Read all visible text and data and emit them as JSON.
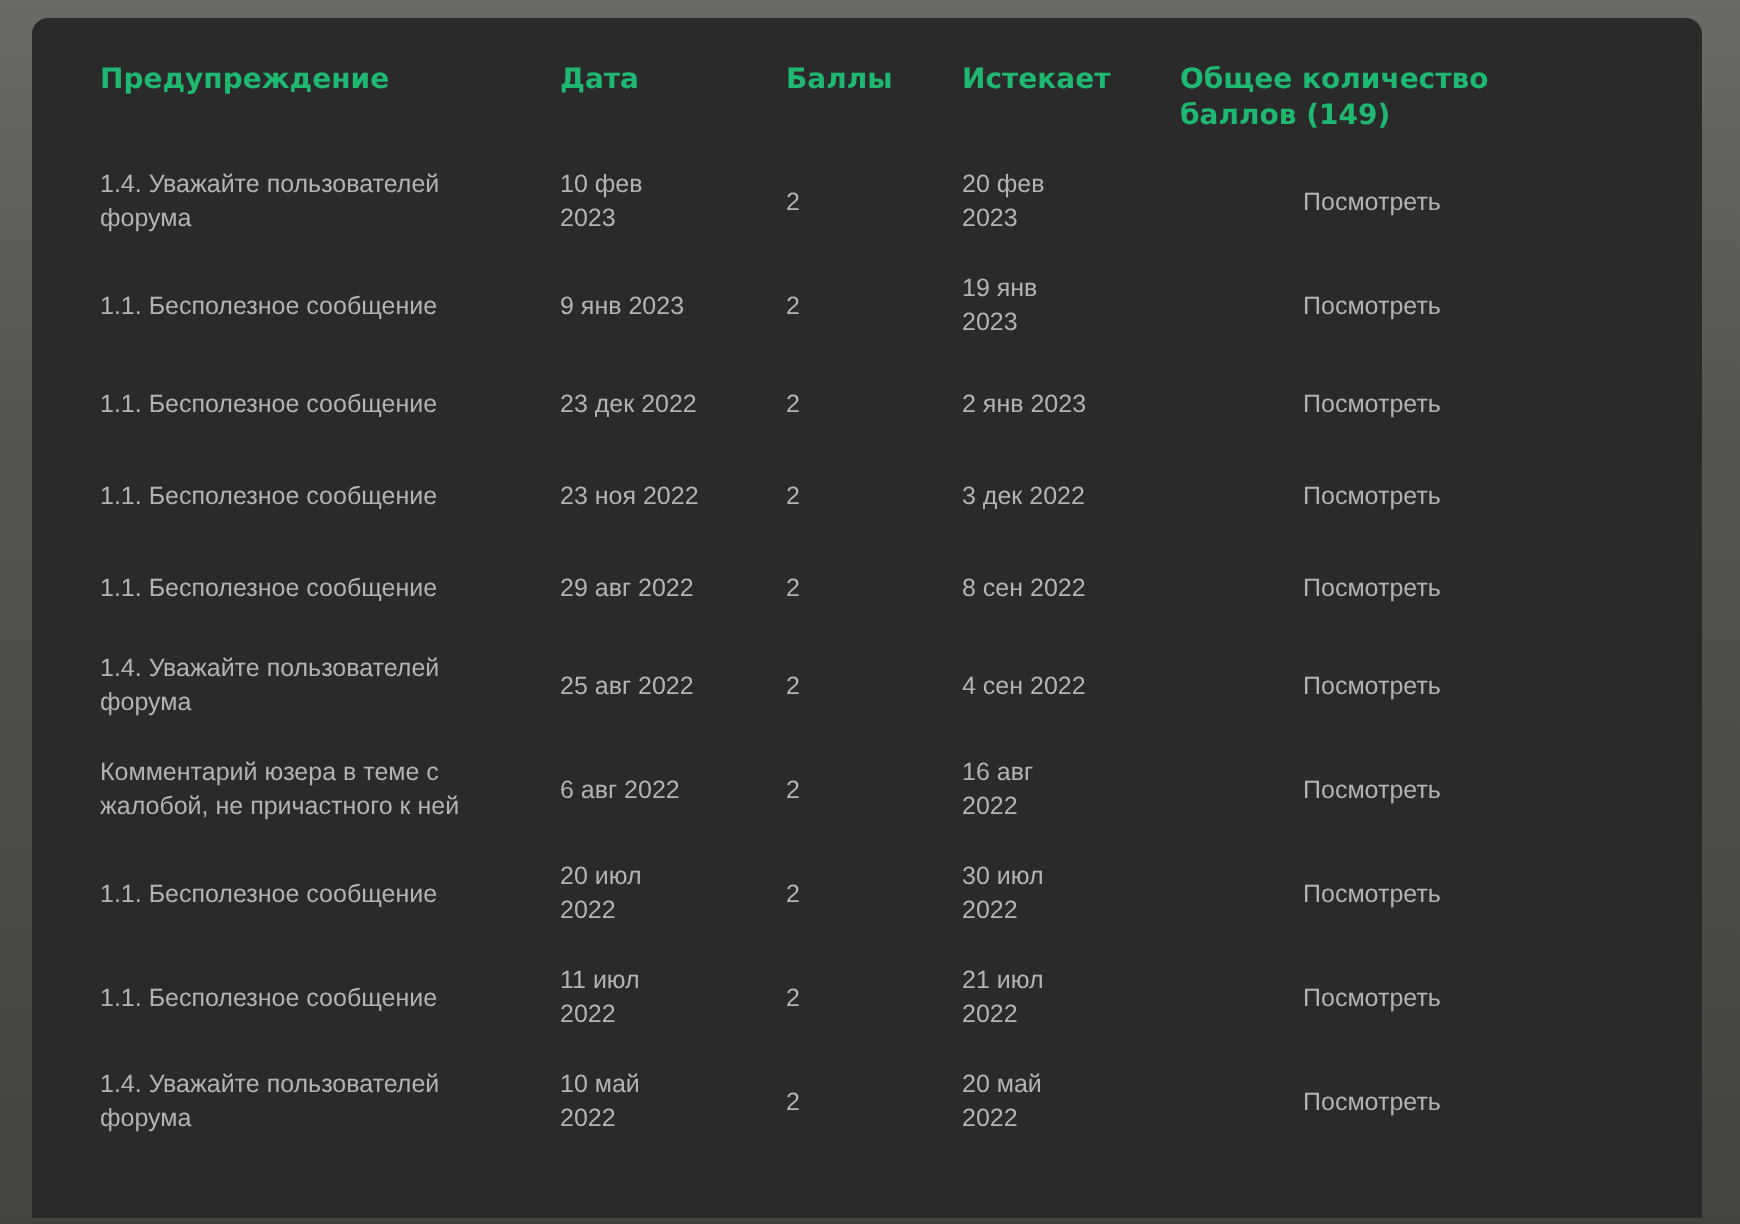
{
  "table": {
    "columns": [
      "Предупреждение",
      "Дата",
      "Баллы",
      "Истекает",
      "Общее количество баллов (149)"
    ],
    "rows": [
      {
        "warning": "1.4. Уважайте пользователей форума",
        "date": "10 фев 2023",
        "points": "2",
        "expires": "20 фев 2023",
        "action": "Посмотреть"
      },
      {
        "warning": "1.1. Бесполезное сообщение",
        "date": "9 янв 2023",
        "points": "2",
        "expires": "19 янв 2023",
        "action": "Посмотреть"
      },
      {
        "warning": "1.1. Бесполезное сообщение",
        "date": "23 дек 2022",
        "points": "2",
        "expires": "2 янв 2023",
        "action": "Посмотреть"
      },
      {
        "warning": "1.1. Бесполезное сообщение",
        "date": "23 ноя 2022",
        "points": "2",
        "expires": "3 дек 2022",
        "action": "Посмотреть"
      },
      {
        "warning": "1.1. Бесполезное сообщение",
        "date": "29 авг 2022",
        "points": "2",
        "expires": "8 сен 2022",
        "action": "Посмотреть"
      },
      {
        "warning": "1.4. Уважайте пользователей форума",
        "date": "25 авг 2022",
        "points": "2",
        "expires": "4 сен 2022",
        "action": "Посмотреть"
      },
      {
        "warning": "Комментарий юзера в теме с жалобой, не причастного к ней",
        "date": "6 авг 2022",
        "points": "2",
        "expires": "16 авг 2022",
        "action": "Посмотреть"
      },
      {
        "warning": "1.1. Бесполезное сообщение",
        "date": "20 июл 2022",
        "points": "2",
        "expires": "30 июл 2022",
        "action": "Посмотреть"
      },
      {
        "warning": "1.1. Бесполезное сообщение",
        "date": "11 июл 2022",
        "points": "2",
        "expires": "21 июл 2022",
        "action": "Посмотреть"
      },
      {
        "warning": "1.4. Уважайте пользователей форума",
        "date": "10 май 2022",
        "points": "2",
        "expires": "20 май 2022",
        "action": "Посмотреть"
      }
    ]
  }
}
